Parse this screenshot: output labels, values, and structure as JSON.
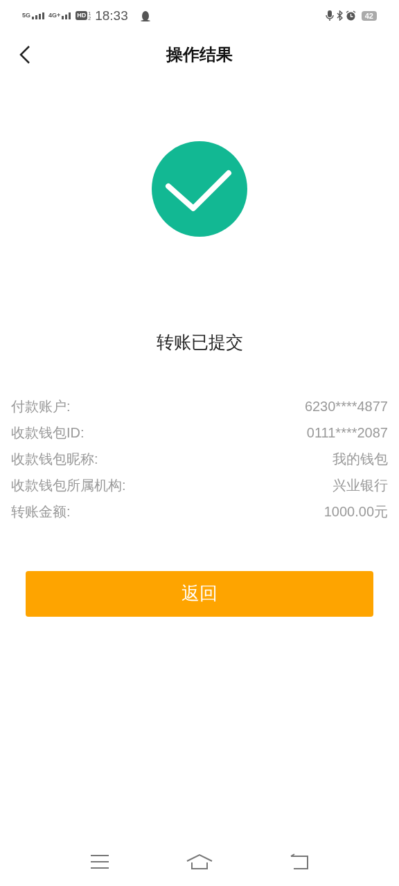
{
  "status_bar": {
    "network_1": "5G",
    "network_2": "4G+",
    "hd": "HD",
    "hd_sim_1": "1",
    "hd_sim_2": "2",
    "time": "18:33",
    "battery": "42"
  },
  "header": {
    "title": "操作结果"
  },
  "result": {
    "message": "转账已提交"
  },
  "details": [
    {
      "label": "付款账户:",
      "value": "6230****4877"
    },
    {
      "label": "收款钱包ID:",
      "value": "0111****2087"
    },
    {
      "label": "收款钱包昵称:",
      "value": "我的钱包"
    },
    {
      "label": "收款钱包所属机构:",
      "value": "兴业银行"
    },
    {
      "label": "转账金额:",
      "value": "1000.00元"
    }
  ],
  "button": {
    "label": "返回"
  }
}
